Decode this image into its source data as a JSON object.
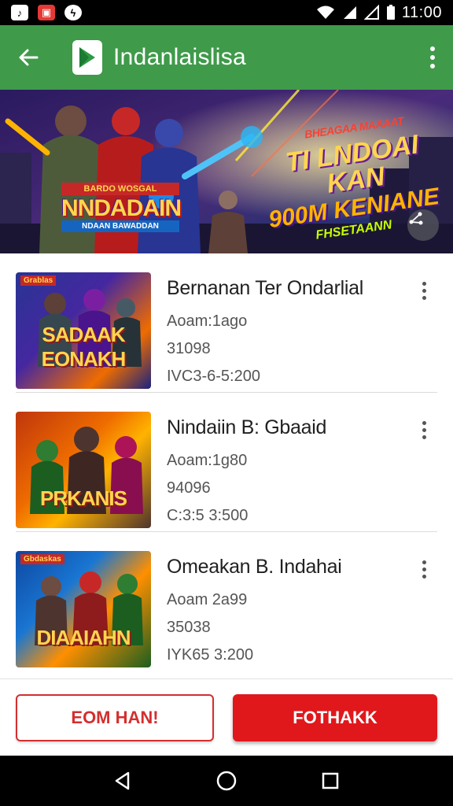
{
  "status_bar": {
    "time": "11:00",
    "left_icons": [
      "tiktok-icon",
      "app-notification-icon",
      "messenger-icon"
    ],
    "right_icons": [
      "wifi-icon",
      "signal-icon",
      "signal-icon",
      "battery-icon"
    ]
  },
  "app_bar": {
    "title": "Indanlaislisa",
    "color": "#3f9a4a"
  },
  "banner": {
    "logo_top": "BARDO WOSGAL",
    "logo_main": "NNDADAIN",
    "logo_sub": "NDAAN BAWADDAN",
    "headline_top": "BHEAGAA MAAAAT",
    "headline_1": "TI LNDOAI KAN",
    "headline_2": "900M KENIANE",
    "headline_3": "FHSETAANN"
  },
  "items": [
    {
      "title": "Bernanan Ter Ondarlial",
      "line1": "Aoam:1ago",
      "line2": "31098",
      "line3": "IVC3-6-5:200",
      "thumb_tag": "Grablas",
      "thumb_title": "SADAAK EONAKH"
    },
    {
      "title": "Nindaiin B: Gbaaid",
      "line1": "Aoam:1g80",
      "line2": "94096",
      "line3": "C:3:5 3:500",
      "thumb_tag": "",
      "thumb_title": "PRKANIS"
    },
    {
      "title": "Omeakan B. Indahai",
      "line1": "Aoam 2a99",
      "line2": "35038",
      "line3": "IYK65 3:200",
      "thumb_tag": "Gbdaskas",
      "thumb_title": "DIAAIAHN"
    }
  ],
  "footer": {
    "outline_button": "EOM HAN!",
    "fill_button": "FOTHAKK",
    "accent": "#e0181c"
  },
  "nav": [
    "back-icon",
    "home-icon",
    "recents-icon"
  ]
}
